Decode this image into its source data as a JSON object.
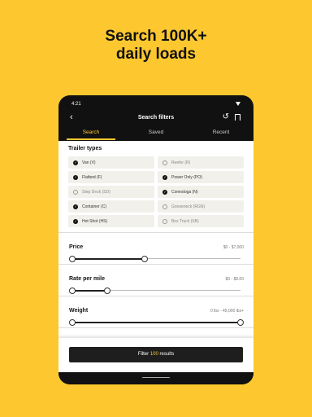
{
  "headline": {
    "line1": "Search 100K+",
    "line2": "daily loads"
  },
  "status": {
    "time": "4:21"
  },
  "header": {
    "back_icon": "arrow-left",
    "title": "Search filters",
    "reset_icon": "undo",
    "bookmark_icon": "bookmark"
  },
  "tabs": [
    {
      "label": "Search",
      "active": true
    },
    {
      "label": "Saved",
      "active": false
    },
    {
      "label": "Recent",
      "active": false
    }
  ],
  "trailer_types": {
    "title": "Trailer types",
    "items": [
      {
        "label": "Van (V)",
        "checked": true
      },
      {
        "label": "Reefer (R)",
        "checked": false
      },
      {
        "label": "Flatbed (F)",
        "checked": true
      },
      {
        "label": "Power Only (PO)",
        "checked": true
      },
      {
        "label": "Step Deck (SD)",
        "checked": false
      },
      {
        "label": "Conestoga (N)",
        "checked": true
      },
      {
        "label": "Container (C)",
        "checked": true
      },
      {
        "label": "Gooseneck (RGN)",
        "checked": false
      },
      {
        "label": "Hot Shot (HS)",
        "checked": true
      },
      {
        "label": "Box Truck (SB)",
        "checked": false
      }
    ]
  },
  "price": {
    "title": "Price",
    "value": "$0 - $7,000",
    "low": 0,
    "high": 0.43
  },
  "rate": {
    "title": "Rate per mile",
    "value": "$0 - $8.00",
    "low": 0,
    "high": 0.21
  },
  "weight": {
    "title": "Weight",
    "value": "0 lbs - 45,000 lbs+",
    "low": 0,
    "high": 1
  },
  "filter_button": {
    "prefix": "Filter",
    "count": "100",
    "suffix": "results"
  },
  "colors": {
    "accent": "#FDC82F",
    "dark": "#111111",
    "chip": "#F1F0EA"
  }
}
